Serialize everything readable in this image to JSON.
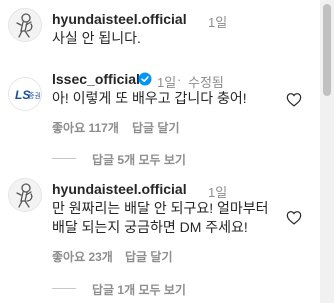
{
  "comments": [
    {
      "username": "hyundaisteel.official",
      "time": "1일",
      "text_lines": [
        "사실 안 됩니다."
      ]
    },
    {
      "username": "lssec_official",
      "time": "1일",
      "edited": "수정됨",
      "text_lines": [
        "아! 이렇게 또 배우고 갑니다 충어!"
      ],
      "likes": "좋아요 117개",
      "reply": "답글 달기",
      "view_replies": "답글 5개 모두 보기",
      "avatar_text": "LS",
      "avatar_sub": "증권"
    },
    {
      "username": "hyundaisteel.official",
      "time": "1일",
      "text_lines": [
        "만 원짜리는 배달 안 되구요! 얼마부터",
        "배달 되는지 궁금하면 DM 주세요!"
      ],
      "likes": "좋아요 23개",
      "reply": "답글 달기",
      "view_replies": "답글 1개 모두 보기"
    }
  ],
  "colors": {
    "text": "#262626",
    "muted": "#8e8e8e",
    "verified": "#0095f6",
    "ls_blue": "#1b4f9c"
  },
  "icons": [
    "monkey-avatar-icon",
    "verified-badge-icon",
    "heart-icon"
  ]
}
